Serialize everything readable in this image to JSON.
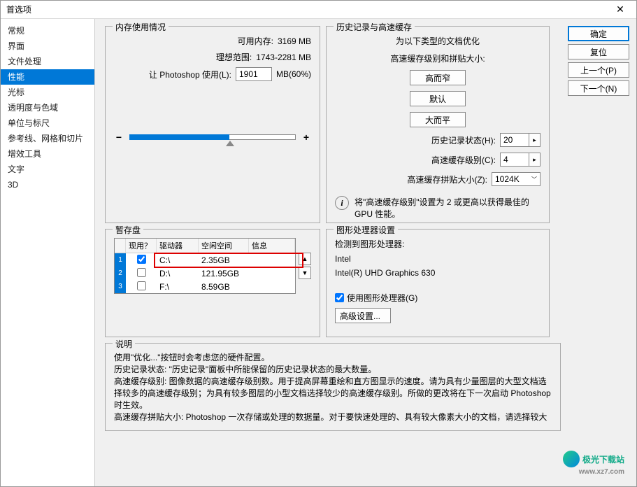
{
  "window": {
    "title": "首选项"
  },
  "sidebar": {
    "items": [
      {
        "label": "常规"
      },
      {
        "label": "界面"
      },
      {
        "label": "文件处理"
      },
      {
        "label": "性能",
        "active": true
      },
      {
        "label": "光标"
      },
      {
        "label": "透明度与色域"
      },
      {
        "label": "单位与标尺"
      },
      {
        "label": "参考线、网格和切片"
      },
      {
        "label": "增效工具"
      },
      {
        "label": "文字"
      },
      {
        "label": "3D"
      }
    ]
  },
  "memory": {
    "legend": "内存使用情况",
    "available_label": "可用内存:",
    "available_value": "3169 MB",
    "ideal_label": "理想范围:",
    "ideal_value": "1743-2281 MB",
    "ps_label": "让 Photoshop 使用(L):",
    "ps_value": "1901",
    "ps_unit": "MB(60%)"
  },
  "history": {
    "legend": "历史记录与高速缓存",
    "title": "为以下类型的文档优化",
    "sub": "高速缓存级别和拼贴大小:",
    "btn_tall": "高而窄",
    "btn_default": "默认",
    "btn_wide": "大而平",
    "states_label": "历史记录状态(H):",
    "states_value": "20",
    "cache_label": "高速缓存级别(C):",
    "cache_value": "4",
    "tile_label": "高速缓存拼贴大小(Z):",
    "tile_value": "1024K",
    "info": "将\"高速缓存级别\"设置为 2 或更高以获得最佳的 GPU 性能。"
  },
  "scratch": {
    "legend": "暂存盘",
    "headers": {
      "idx": "",
      "active": "现用？",
      "drive": "驱动器",
      "free": "空闲空间",
      "info": "信息"
    },
    "rows": [
      {
        "idx": "1",
        "active": true,
        "drive": "C:\\",
        "free": "2.35GB"
      },
      {
        "idx": "2",
        "active": false,
        "drive": "D:\\",
        "free": "121.95GB"
      },
      {
        "idx": "3",
        "active": false,
        "drive": "F:\\",
        "free": "8.59GB"
      }
    ]
  },
  "gpu": {
    "legend": "图形处理器设置",
    "detected_label": "检测到图形处理器:",
    "vendor": "Intel",
    "model": "Intel(R) UHD Graphics 630",
    "use_gpu_label": "使用图形处理器(G)",
    "use_gpu_checked": true,
    "advanced_label": "高级设置..."
  },
  "description": {
    "legend": "说明",
    "line1": "使用\"优化...\"按钮时会考虑您的硬件配置。",
    "line2": "历史记录状态: \"历史记录\"面板中所能保留的历史记录状态的最大数量。",
    "line3": "高速缓存级别: 图像数据的高速缓存级别数。用于提高屏幕重绘和直方图显示的速度。请为具有少量图层的大型文档选择较多的高速缓存级别；为具有较多图层的小型文档选择较少的高速缓存级别。所做的更改将在下一次启动 Photoshop 时生效。",
    "line4": "高速缓存拼贴大小: Photoshop 一次存储或处理的数据量。对于要快速处理的、具有较大像素大小的文档，请选择较大"
  },
  "buttons": {
    "ok": "确定",
    "reset": "复位",
    "prev": "上一个(P)",
    "next": "下一个(N)"
  },
  "watermark": {
    "text": "极光下载站",
    "url": "www.xz7.com"
  }
}
